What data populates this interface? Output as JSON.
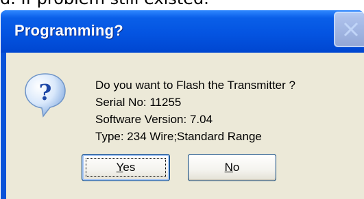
{
  "background_text": "d. If problem still existed.",
  "dialog": {
    "title": "Programming?",
    "message_lines": [
      "Do you want to Flash the Transmitter ?",
      "Serial No: 11255",
      "Software Version: 7.04",
      "Type: 234 Wire;Standard Range"
    ],
    "buttons": {
      "yes_first": "Y",
      "yes_rest": "es",
      "no_first": "N",
      "no_rest": "o"
    },
    "icon": "question-icon",
    "close_icon": "close-icon"
  }
}
